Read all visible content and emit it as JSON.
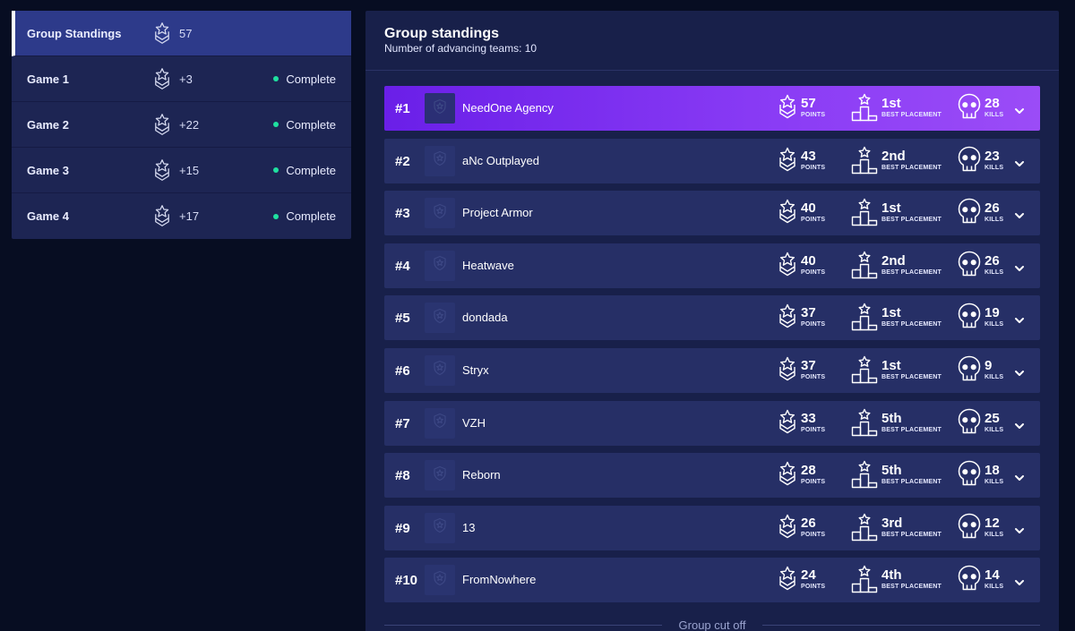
{
  "sidebar": {
    "items": [
      {
        "label": "Group Standings",
        "points": "57",
        "status": "",
        "active": true
      },
      {
        "label": "Game 1",
        "points": "+3",
        "status": "Complete",
        "active": false
      },
      {
        "label": "Game 2",
        "points": "+22",
        "status": "Complete",
        "active": false
      },
      {
        "label": "Game 3",
        "points": "+15",
        "status": "Complete",
        "active": false
      },
      {
        "label": "Game 4",
        "points": "+17",
        "status": "Complete",
        "active": false
      }
    ],
    "icon": "points-badge-icon",
    "status_color": "#1fe0a0"
  },
  "main": {
    "title": "Group standings",
    "subtitle": "Number of advancing teams: 10",
    "captions": {
      "points": "POINTS",
      "placement": "BEST PLACEMENT",
      "kills": "KILLS"
    },
    "teams": [
      {
        "rank": "#1",
        "name": "NeedOne Agency",
        "points": "57",
        "placement": "1st",
        "kills": "28"
      },
      {
        "rank": "#2",
        "name": "aNc Outplayed",
        "points": "43",
        "placement": "2nd",
        "kills": "23"
      },
      {
        "rank": "#3",
        "name": "Project Armor",
        "points": "40",
        "placement": "1st",
        "kills": "26"
      },
      {
        "rank": "#4",
        "name": "Heatwave",
        "points": "40",
        "placement": "2nd",
        "kills": "26"
      },
      {
        "rank": "#5",
        "name": "dondada",
        "points": "37",
        "placement": "1st",
        "kills": "19"
      },
      {
        "rank": "#6",
        "name": "Stryx",
        "points": "37",
        "placement": "1st",
        "kills": "9"
      },
      {
        "rank": "#7",
        "name": "VZH",
        "points": "33",
        "placement": "5th",
        "kills": "25"
      },
      {
        "rank": "#8",
        "name": "Reborn",
        "points": "28",
        "placement": "5th",
        "kills": "18"
      },
      {
        "rank": "#9",
        "name": "13",
        "points": "26",
        "placement": "3rd",
        "kills": "12"
      },
      {
        "rank": "#10",
        "name": "FromNowhere",
        "points": "24",
        "placement": "4th",
        "kills": "14"
      }
    ],
    "cutoff_label": "Group cut off",
    "highlight_gradient": [
      "#6a1fe8",
      "#9b4cf7"
    ]
  }
}
